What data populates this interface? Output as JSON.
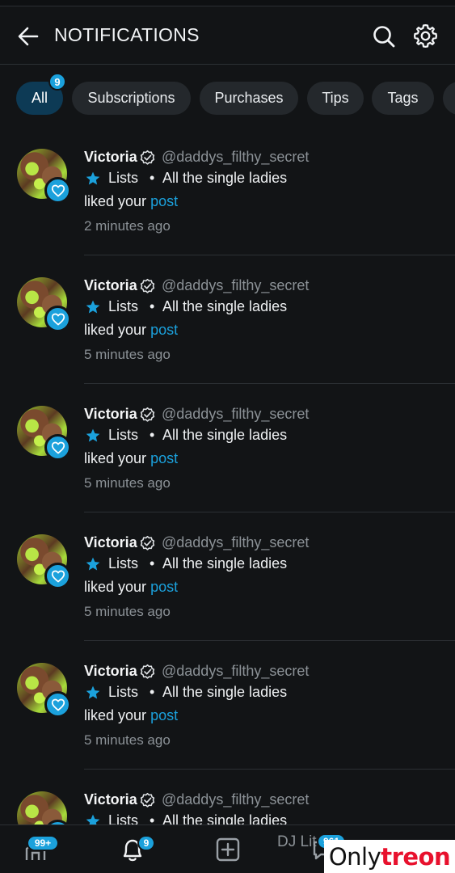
{
  "header": {
    "title": "NOTIFICATIONS"
  },
  "filters": [
    {
      "label": "All",
      "active": true,
      "badge": "9"
    },
    {
      "label": "Subscriptions",
      "active": false
    },
    {
      "label": "Purchases",
      "active": false
    },
    {
      "label": "Tips",
      "active": false
    },
    {
      "label": "Tags",
      "active": false
    }
  ],
  "notifications": [
    {
      "name": "Victoria",
      "handle": "@daddys_filthy_secret",
      "list_label": "Lists",
      "list_name": "All the single ladies",
      "action": "liked your",
      "link": "post",
      "time": "2 minutes ago"
    },
    {
      "name": "Victoria",
      "handle": "@daddys_filthy_secret",
      "list_label": "Lists",
      "list_name": "All the single ladies",
      "action": "liked your",
      "link": "post",
      "time": "5 minutes ago"
    },
    {
      "name": "Victoria",
      "handle": "@daddys_filthy_secret",
      "list_label": "Lists",
      "list_name": "All the single ladies",
      "action": "liked your",
      "link": "post",
      "time": "5 minutes ago"
    },
    {
      "name": "Victoria",
      "handle": "@daddys_filthy_secret",
      "list_label": "Lists",
      "list_name": "All the single ladies",
      "action": "liked your",
      "link": "post",
      "time": "5 minutes ago"
    },
    {
      "name": "Victoria",
      "handle": "@daddys_filthy_secret",
      "list_label": "Lists",
      "list_name": "All the single ladies",
      "action": "liked your",
      "link": "post",
      "time": "5 minutes ago"
    },
    {
      "name": "Victoria",
      "handle": "@daddys_filthy_secret",
      "list_label": "Lists",
      "list_name": "All the single ladies",
      "action": "",
      "link": "",
      "time": ""
    }
  ],
  "bottom_nav": {
    "home_badge": "99+",
    "notifications_badge": "9",
    "messages_badge": "961",
    "partial_text": "DJ Lit"
  },
  "watermark": {
    "part1": "Only",
    "part2": "treon"
  },
  "colors": {
    "accent": "#1ba1dc",
    "background": "#121416",
    "chip": "#24282c",
    "chip_active": "#0d3a55",
    "muted_text": "#8b9196"
  }
}
